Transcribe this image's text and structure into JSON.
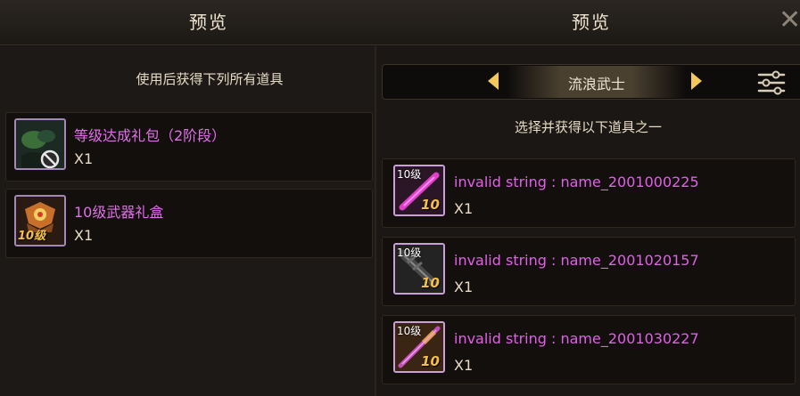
{
  "header": {
    "left_title": "预览",
    "right_title": "预览",
    "close_glyph": "✕"
  },
  "left_panel": {
    "subtitle": "使用后获得下列所有道具",
    "items": [
      {
        "name": "等级达成礼包（2阶段）",
        "qty": "X1",
        "icon": "gift-pack-disabled-icon"
      },
      {
        "name": "10级武器礼盒",
        "qty": "X1",
        "icon": "weapon-box-icon",
        "badge": "10级"
      }
    ]
  },
  "right_panel": {
    "class_name": "流浪武士",
    "subtitle": "选择并获得以下道具之一",
    "weapons": [
      {
        "name": "invalid string : name_2001000225",
        "qty": "X1",
        "level_tag": "10级",
        "level_num": "10"
      },
      {
        "name": "invalid string : name_2001020157",
        "qty": "X1",
        "level_tag": "10级",
        "level_num": "10"
      },
      {
        "name": "invalid string : name_2001030227",
        "qty": "X1",
        "level_tag": "10级",
        "level_num": "10"
      }
    ]
  },
  "colors": {
    "item_name": "#e070e8",
    "arrow": "#f2c85a",
    "background": "#171411"
  }
}
